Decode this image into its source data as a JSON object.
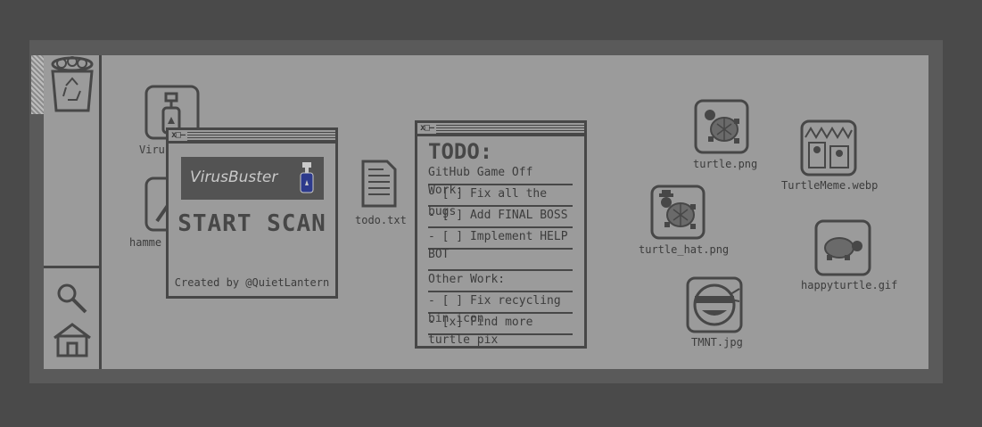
{
  "desktop": {
    "icons": [
      {
        "name": "Virus",
        "label": "Virus"
      },
      {
        "name": "hammer",
        "label": "hamme"
      },
      {
        "name": "todo",
        "label": "todo.txt"
      },
      {
        "name": "turtle",
        "label": "turtle.png"
      },
      {
        "name": "turtle_hat",
        "label": "turtle_hat.png"
      },
      {
        "name": "turtlememe",
        "label": "TurtleMeme.webp"
      },
      {
        "name": "happyturtle",
        "label": "happyturtle.gif"
      },
      {
        "name": "tmnt",
        "label": "TMNT.jpg"
      }
    ]
  },
  "virusbuster": {
    "window_buttons": "x□—",
    "banner": "VirusBuster",
    "start": "START SCAN",
    "credit": "Created by @QuietLantern"
  },
  "todo": {
    "window_buttons": "x□—",
    "title": "TODO:",
    "lines": [
      "GitHub Game Off Work:",
      "- [ ] Fix all the bugs",
      "- [ ] Add FINAL BOSS",
      "- [ ] Implement HELP BOT",
      "",
      "Other Work:",
      "- [ ] Fix recycling bin icon",
      "- [x] Find more turtle pix"
    ]
  },
  "colors": {
    "screen": "#9b9b9b",
    "ink": "#474747",
    "monitor": "#5a5a5a",
    "background": "#4a4a4a"
  }
}
